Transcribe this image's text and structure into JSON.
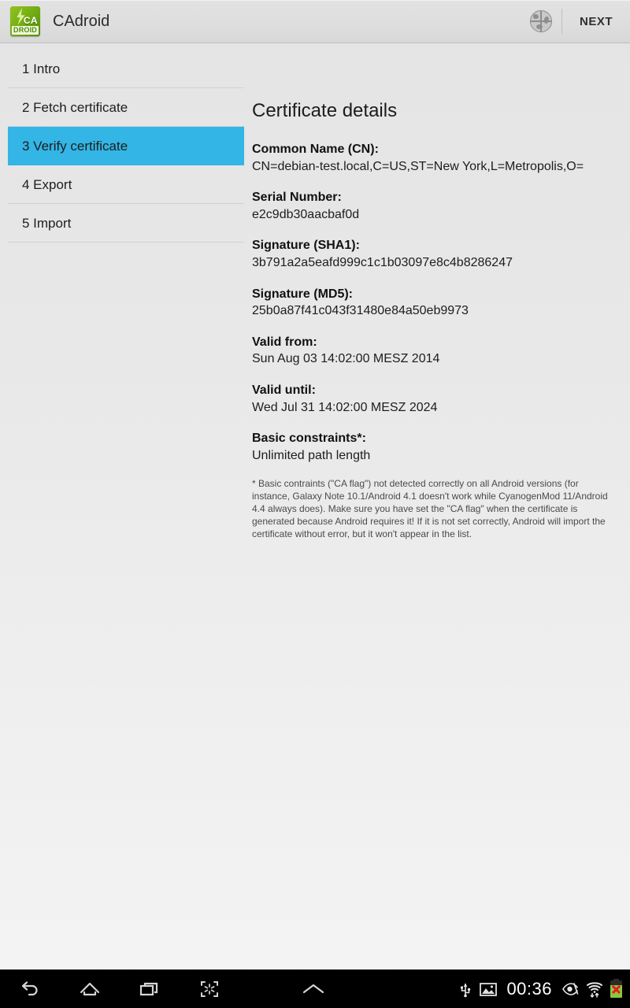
{
  "actionbar": {
    "app_name": "CAdroid",
    "icon_text_top": "CA",
    "icon_text_bottom": "DROID",
    "globe_icon": "globe-icon",
    "next_label": "NEXT"
  },
  "sidebar": {
    "items": [
      {
        "label": "1 Intro",
        "selected": false
      },
      {
        "label": "2 Fetch certificate",
        "selected": false
      },
      {
        "label": "3 Verify certificate",
        "selected": true
      },
      {
        "label": "4 Export",
        "selected": false
      },
      {
        "label": "5 Import",
        "selected": false
      }
    ],
    "selected_color": "#33b5e5"
  },
  "main": {
    "title": "Certificate details",
    "fields": [
      {
        "label": "Common Name (CN):",
        "value": "CN=debian-test.local,C=US,ST=New York,L=Metropolis,O="
      },
      {
        "label": "Serial Number:",
        "value": "e2c9db30aacbaf0d"
      },
      {
        "label": "Signature (SHA1):",
        "value": "3b791a2a5eafd999c1c1b03097e8c4b8286247"
      },
      {
        "label": "Signature (MD5):",
        "value": "25b0a87f41c043f31480e84a50eb9973"
      },
      {
        "label": "Valid from:",
        "value": "Sun Aug 03 14:02:00 MESZ 2014"
      },
      {
        "label": "Valid until:",
        "value": "Wed Jul 31 14:02:00 MESZ 2024"
      },
      {
        "label": "Basic constraints*:",
        "value": "Unlimited path length"
      }
    ],
    "footnote": "* Basic contraints (\"CA flag\") not detected correctly on all Android versions (for instance, Galaxy Note 10.1/Android 4.1 doesn't work while CyanogenMod 11/Android 4.4 always does). Make sure you have set the \"CA flag\" when the certificate is generated because Android requires it! If it is not set correctly, Android will import the certificate without error, but it won't appear in the list."
  },
  "navbar": {
    "buttons": [
      {
        "name": "back-icon"
      },
      {
        "name": "home-icon"
      },
      {
        "name": "recents-icon"
      },
      {
        "name": "screenshot-icon"
      },
      {
        "name": "chevron-up-icon"
      }
    ],
    "status": {
      "usb_icon": "usb-icon",
      "screenshot_notification_icon": "image-icon",
      "clock": "00:36",
      "eye_icon": "eye-icon",
      "wifi_icon": "wifi-icon",
      "battery_icon": "battery-error-icon"
    }
  }
}
